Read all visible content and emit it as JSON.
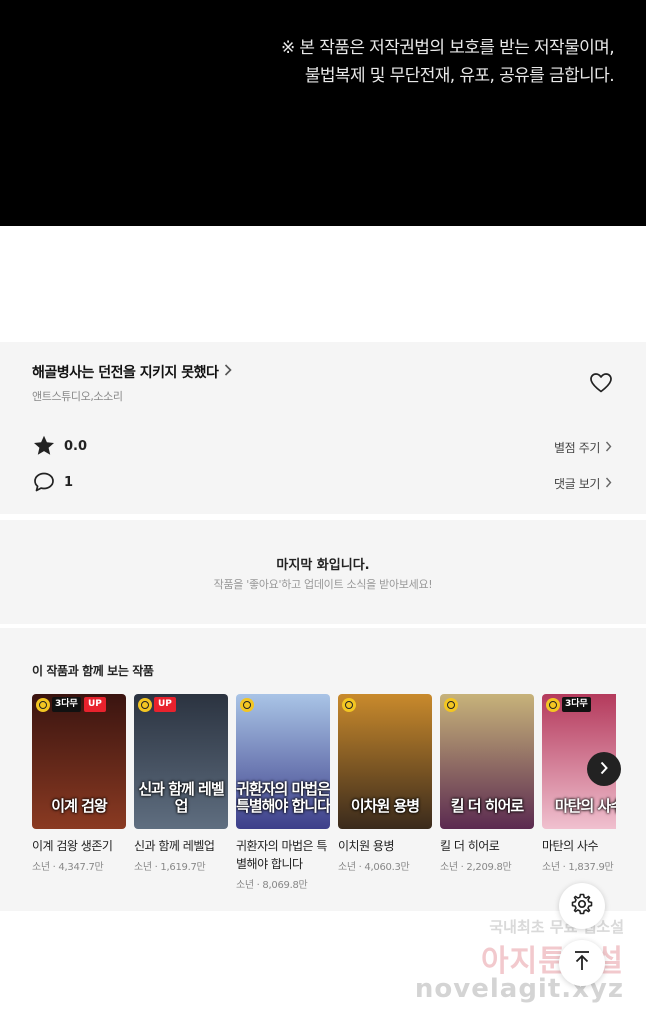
{
  "banner": {
    "line1": "※ 본 작품은 저작권법의 보호를 받는 저작물이며,",
    "line2": "불법복제 및 무단전재, 유포, 공유를 금합니다."
  },
  "work": {
    "title": "해골병사는 던전을 지키지 못했다",
    "author": "앤트스튜디오,소소리",
    "rating": "0.0",
    "comments": "1",
    "rate_label": "별점 주기",
    "comments_label": "댓글 보기"
  },
  "last_episode": {
    "title": "마지막 화입니다.",
    "subtitle": "작품을 '좋아요'하고 업데이트 소식을 받아보세요!"
  },
  "recommend": {
    "heading": "이 작품과 함께 보는 작품",
    "items": [
      {
        "name": "이계 검왕 생존기",
        "meta": "소년 · 4,347.7만",
        "cover_text": "이계 검왕",
        "badge": "3다무",
        "up": "UP",
        "color_top": "#3a1410",
        "color_bottom": "#8a3a22"
      },
      {
        "name": "신과 함께 레벨업",
        "meta": "소년 · 1,619.7만",
        "cover_text": "신과 함께 레벨업",
        "badge": "",
        "up": "UP",
        "color_top": "#2b3340",
        "color_bottom": "#5f6e80"
      },
      {
        "name": "귀환자의 마법은 특별해야 합니다",
        "meta": "소년 · 8,069.8만",
        "cover_text": "귀환자의 마법은 특별해야 합니다",
        "badge": "",
        "up": "",
        "color_top": "#a9c4e6",
        "color_bottom": "#3d3f8a"
      },
      {
        "name": "이치원 용병",
        "meta": "소년 · 4,060.3만",
        "cover_text": "이차원 용병",
        "badge": "",
        "up": "",
        "color_top": "#c98a2c",
        "color_bottom": "#3a2a1c"
      },
      {
        "name": "킬 더 히어로",
        "meta": "소년 · 2,209.8만",
        "cover_text": "킬 더 히어로",
        "badge": "",
        "up": "",
        "color_top": "#c7b37a",
        "color_bottom": "#5b2a50"
      },
      {
        "name": "마탄의 사수",
        "meta": "소년 · 1,837.9만",
        "cover_text": "마탄의 사수",
        "badge": "3다무",
        "up": "",
        "color_top": "#b43a5c",
        "color_bottom": "#f0c0cf"
      }
    ]
  },
  "watermark": {
    "line1": "국내최초 무료 웹소설",
    "line2": "아지툰소설",
    "line3": "novelagit.xyz"
  },
  "icons": {
    "heart": "heart-icon",
    "star": "star-icon",
    "comment": "comment-icon",
    "settings": "gear-icon",
    "top": "arrow-up-icon",
    "next": "chevron-right-icon"
  }
}
